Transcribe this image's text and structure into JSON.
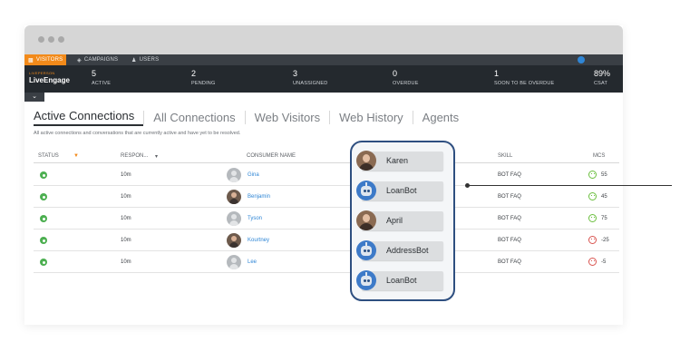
{
  "nav": {
    "items": [
      {
        "label": "VISITORS",
        "icon": "chat-icon"
      },
      {
        "label": "CAMPAIGNS",
        "icon": "tag-icon"
      },
      {
        "label": "USERS",
        "icon": "user-icon"
      }
    ],
    "accent": "#f28a1a"
  },
  "brand": {
    "top": "LIVEPERSON",
    "main": "LiveEngage"
  },
  "stats": [
    {
      "value": "5",
      "label": "ACTIVE"
    },
    {
      "value": "2",
      "label": "PENDING"
    },
    {
      "value": "3",
      "label": "UNASSIGNED"
    },
    {
      "value": "0",
      "label": "OVERDUE"
    },
    {
      "value": "1",
      "label": "SOON TO BE OVERDUE"
    },
    {
      "value": "89%",
      "label": "CSAT"
    }
  ],
  "tabs": [
    "Active Connections",
    "All Connections",
    "Web Visitors",
    "Web History",
    "Agents"
  ],
  "subtitle": "All active connections and conversations that are currently active and have yet to be resolved.",
  "columns": {
    "status": "STATUS",
    "response": "RESPON...",
    "consumer": "CONSUMER NAME",
    "skill": "SKILL",
    "mcs": "MCS"
  },
  "rows": [
    {
      "response": "10m",
      "name": "Gina",
      "skill": "BOT FAQ",
      "mcs": "55",
      "mood": "happy",
      "photo": false
    },
    {
      "response": "10m",
      "name": "Benjamin",
      "skill": "BOT FAQ",
      "mcs": "45",
      "mood": "happy",
      "photo": true
    },
    {
      "response": "10m",
      "name": "Tyson",
      "skill": "BOT FAQ",
      "mcs": "75",
      "mood": "happy",
      "photo": false
    },
    {
      "response": "10m",
      "name": "Kourtney",
      "skill": "BOT FAQ",
      "mcs": "-25",
      "mood": "sad",
      "photo": true
    },
    {
      "response": "10m",
      "name": "Lee",
      "skill": "BOT FAQ",
      "mcs": "-5",
      "mood": "sad",
      "photo": false
    }
  ],
  "agents": [
    {
      "name": "Karen",
      "type": "human"
    },
    {
      "name": "LoanBot",
      "type": "bot"
    },
    {
      "name": "April",
      "type": "human"
    },
    {
      "name": "AddressBot",
      "type": "bot"
    },
    {
      "name": "LoanBot",
      "type": "bot"
    }
  ],
  "colors": {
    "panel_border": "#2e4f80",
    "link": "#2f86d6",
    "status_green": "#4caf50",
    "happy": "#6bbf3f",
    "sad": "#d9534f"
  }
}
